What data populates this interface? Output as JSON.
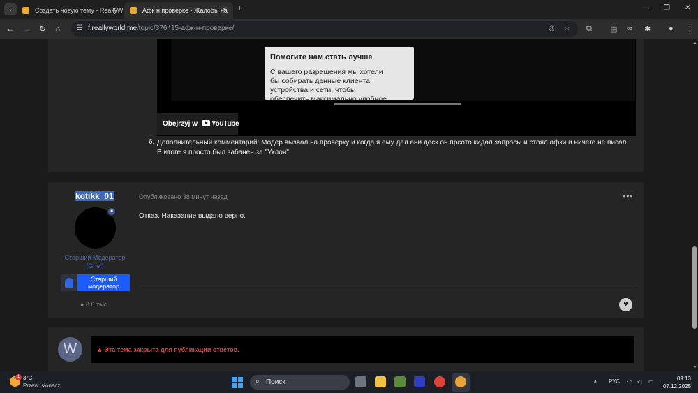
{
  "browser": {
    "tabs": [
      {
        "title": "Создать новую тему - ReallyW",
        "active": false
      },
      {
        "title": "Афк н проверке - Жалобы на",
        "active": true
      }
    ],
    "url_host": "f.reallyworld.me",
    "url_path": "/topic/376415-афк-н-проверке/"
  },
  "post1": {
    "video": {
      "consent_title": "Помогите нам стать лучше",
      "consent_text": "С вашего разрешения мы хотели бы собирать данные клиента, устройства и сети, чтобы обеспечить максимально удобное",
      "watch_on": "Obejrzyj w",
      "youtube": "YouTube"
    },
    "list_number": "6.",
    "list_text": "Дополнительный комментарий:  Модер вызвал на проверку и когда я ему дал ани деск он прсото кидал запросы и стоял афки и ничего не писал. В итоге я просто был забанен за \"Уклон\""
  },
  "post2": {
    "author": "kotikk_01",
    "role": "Старший Модератор (Grief)",
    "rank_label": "Старший модератор",
    "reputation": "8.6 тыс",
    "posted": "Опубликовано 38 минут назад",
    "more": "•••",
    "content": "Отказ. Наказание выдано верно."
  },
  "post3": {
    "avatar_letter": "W",
    "locked_text": "Эта тема закрыта для публикации ответов."
  },
  "taskbar": {
    "temperature": "3°C",
    "condition": "Przew. słonecz.",
    "weather_badge": "1",
    "search": "Поиск",
    "language": "РУС",
    "time": "09:13",
    "date": "07.12.2025"
  }
}
